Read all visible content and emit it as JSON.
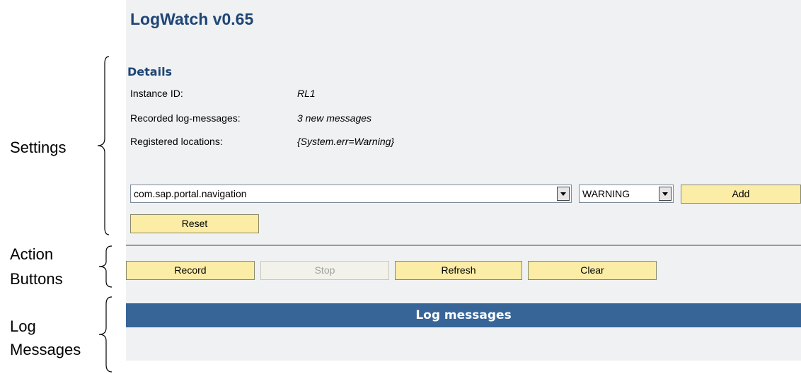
{
  "app": {
    "title": "LogWatch v0.65"
  },
  "details": {
    "title": "Details",
    "rows": [
      {
        "label": "Instance ID:",
        "value": "RL1"
      },
      {
        "label": "Recorded log-messages:",
        "value": "3 new messages"
      },
      {
        "label": "Registered locations:",
        "value": "{System.err=Warning}"
      }
    ]
  },
  "location_select": {
    "value": "com.sap.portal.navigation"
  },
  "severity_select": {
    "value": "WARNING"
  },
  "buttons": {
    "add": "Add",
    "reset": "Reset",
    "record": "Record",
    "stop": "Stop",
    "refresh": "Refresh",
    "clear": "Clear"
  },
  "log_messages": {
    "header": "Log messages"
  },
  "annotations": {
    "settings": "Settings",
    "action_buttons_line1": "Action",
    "action_buttons_line2": "Buttons",
    "log_messages_line1": "Log",
    "log_messages_line2": "Messages"
  },
  "colors": {
    "title_blue": "#1f4575",
    "header_bar": "#386597",
    "button_fill": "#fbeca6",
    "panel_bg": "#eff1f3"
  },
  "states": {
    "stop_button": "disabled"
  }
}
